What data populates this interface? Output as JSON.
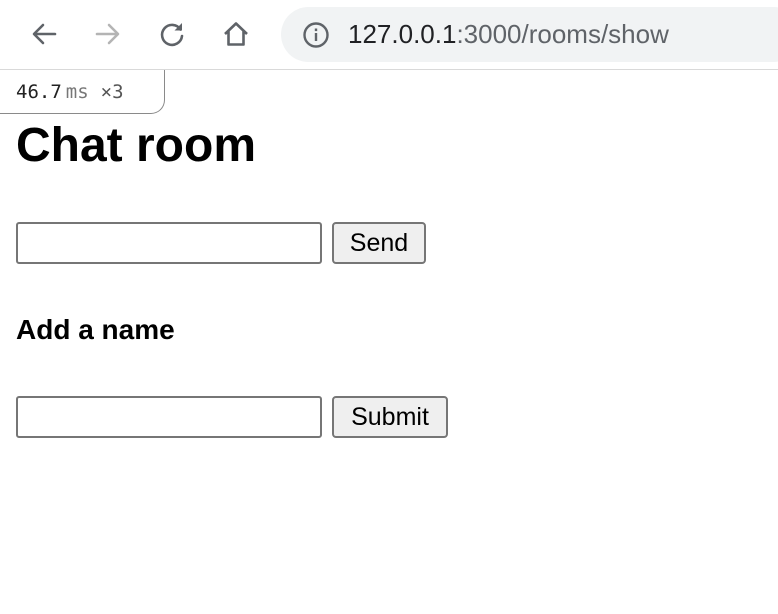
{
  "browser": {
    "url_host": "127.0.0.1",
    "url_path": ":3000/rooms/show",
    "icons": {
      "back": "arrow-left-icon",
      "forward": "arrow-right-icon",
      "reload": "reload-icon",
      "home": "home-icon",
      "site_info": "info-icon"
    }
  },
  "debug_badge": {
    "time": "46.7",
    "unit": "ms",
    "count": "×3"
  },
  "page": {
    "title": "Chat room",
    "message_input": {
      "value": "",
      "placeholder": ""
    },
    "send_label": "Send",
    "name_heading": "Add a name",
    "name_input": {
      "value": "",
      "placeholder": ""
    },
    "submit_label": "Submit"
  }
}
